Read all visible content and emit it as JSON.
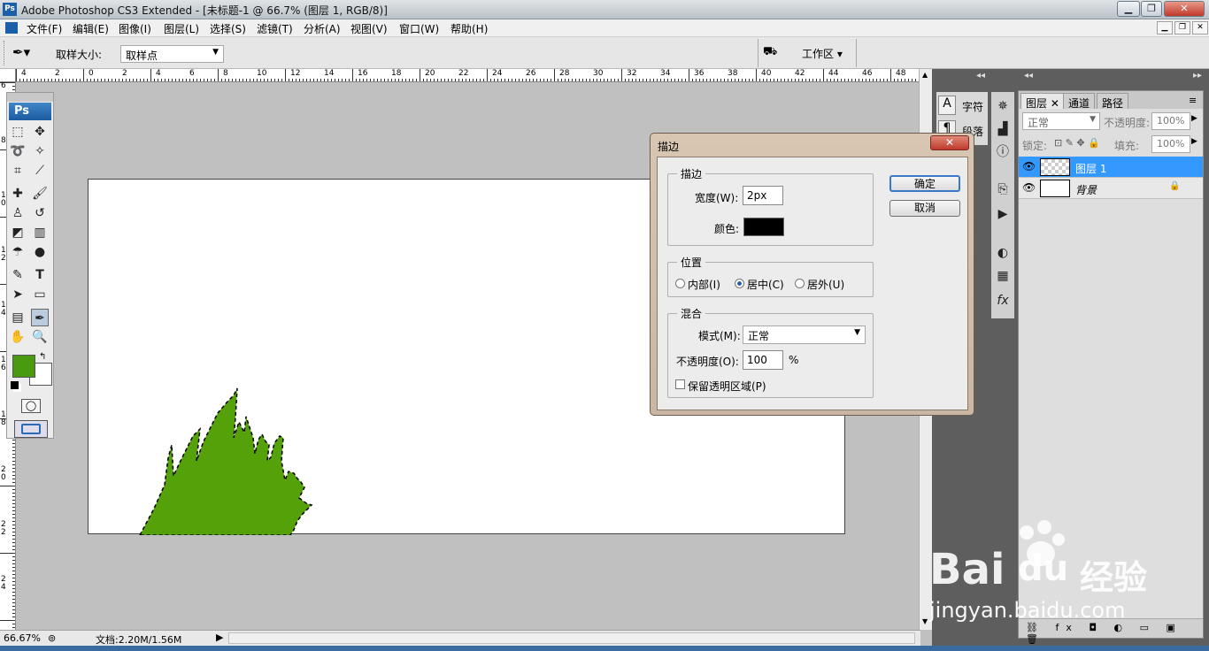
{
  "window": {
    "title": "Adobe Photoshop CS3 Extended - [未标题-1 @ 66.7% (图层 1, RGB/8)]",
    "app_icon": "Ps",
    "min": "▁",
    "max": "❐",
    "close": "✕"
  },
  "menu": [
    "文件(F)",
    "编辑(E)",
    "图像(I)",
    "图层(L)",
    "选择(S)",
    "滤镜(T)",
    "分析(A)",
    "视图(V)",
    "窗口(W)",
    "帮助(H)"
  ],
  "options": {
    "sample_size_label": "取样大小:",
    "sample_size_value": "取样点",
    "workspace_label": "工作区 ▾"
  },
  "ruler": {
    "h_labels": [
      "4",
      "2",
      "0",
      "2",
      "4",
      "6",
      "8",
      "10",
      "12",
      "14",
      "16",
      "18",
      "20",
      "22",
      "24",
      "26",
      "28",
      "30",
      "32",
      "34",
      "36",
      "38",
      "40",
      "42",
      "44",
      "46",
      "48"
    ],
    "v_labels": [
      "6",
      "8",
      "1 0",
      "1 2",
      "1 4",
      "1 6",
      "1 8",
      "2 0",
      "2 2",
      "2 4"
    ]
  },
  "status": {
    "zoom": "66.67%",
    "doc_size": "文档:2.20M/1.56M"
  },
  "dock": {
    "char_tab": "字符",
    "para_tab": "段落"
  },
  "layers_panel": {
    "tabs": [
      "图层",
      "通道",
      "路径"
    ],
    "blend_mode": "正常",
    "opacity_label": "不透明度:",
    "opacity_value": "100%",
    "lock_label": "锁定:",
    "fill_label": "填充:",
    "fill_value": "100%",
    "layers": [
      {
        "name": "图层 1",
        "selected": true
      },
      {
        "name": "背景",
        "selected": false
      }
    ]
  },
  "dialog": {
    "title": "描边",
    "stroke_group": "描边",
    "width_label": "宽度(W):",
    "width_value": "2px",
    "color_label": "颜色:",
    "color_value": "#000000",
    "position_group": "位置",
    "position_options": [
      "内部(I)",
      "居中(C)",
      "居外(U)"
    ],
    "position_selected": "居中(C)",
    "blend_group": "混合",
    "mode_label": "模式(M):",
    "mode_value": "正常",
    "opacity_label": "不透明度(O):",
    "opacity_value": "100",
    "percent": "%",
    "preserve_label": "保留透明区域(P)",
    "ok": "确定",
    "cancel": "取消"
  },
  "colors": {
    "foreground": "#4a9a10",
    "background": "#ffffff",
    "grass": "#55a10a"
  },
  "watermark": {
    "brand": "Bai",
    "brand2": "du",
    "cn": "经验",
    "url": "jingyan.baidu.com"
  }
}
